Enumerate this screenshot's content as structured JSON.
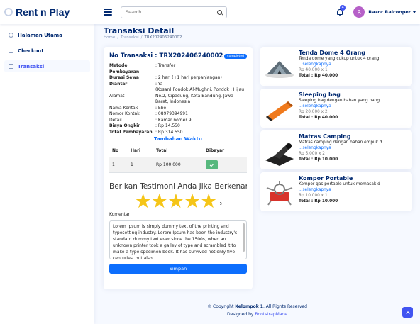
{
  "header": {
    "logo": "Rent n Play",
    "search_placeholder": "Search",
    "notif_count": "4",
    "avatar_letter": "R",
    "user_name": "Razor Raicooper"
  },
  "sidebar": {
    "items": [
      {
        "label": "Halaman Utama",
        "icon": "home-icon"
      },
      {
        "label": "Checkout",
        "icon": "cart-icon"
      },
      {
        "label": "Transaksi",
        "icon": "bag-icon",
        "active": true
      }
    ]
  },
  "page": {
    "title": "Transaksi Detail",
    "breadcrumb": [
      "Home",
      "/",
      "Transaksi",
      "/",
      "TRX202406240002"
    ]
  },
  "transaction": {
    "title_label": "No Transaksi :",
    "number": "TRX202406240002",
    "status": "completed",
    "rows": [
      {
        "k": "Metode Pembayaran",
        "v": ": Transfer",
        "bold": true
      },
      {
        "k": "Durasi Sewa",
        "v": ": 2 hari (+1 hari perpanjangan)",
        "bold": true
      },
      {
        "k": "Diantar",
        "v": ": Ya",
        "bold": true
      },
      {
        "k": "Alamat",
        "v": "(Kosan) Pondok Al-Mughni, Pondok : Hijau No.2, Cipadung, Kota Bandung, Jawa Barat, Indonesia",
        "bold": false
      },
      {
        "k": "Nama Kontak",
        "v": ": Ebe",
        "bold": false
      },
      {
        "k": "Nomor Kontak",
        "v": ": 08979394991",
        "bold": false
      },
      {
        "k": "Detail",
        "v": ": Kamar nomer 9",
        "bold": false
      },
      {
        "k": "Biaya Ongkir",
        "v": ": Rp 14.550",
        "bold": true
      },
      {
        "k": "Total Pembayaran",
        "v": ": Rp 314.550",
        "bold": true
      }
    ],
    "tambahan_title": "Tambahan Waktu",
    "table_headers": [
      "No",
      "Hari",
      "Total",
      "Dibayar"
    ],
    "table_rows": [
      {
        "no": "1",
        "hari": "1",
        "total": "Rp 100.000"
      }
    ]
  },
  "testimoni": {
    "title": "Berikan Testimoni Anda Jika Berkenan",
    "rating": 5,
    "rating_label": "5",
    "komentar_label": "Komentar",
    "komentar_text": "Lorem Ipsum is simply dummy text of the printing and typesetting industry. Lorem Ipsum has been the industry's standard dummy text ever since the 1500s, when an unknown printer took a galley of type and scrambled it to make a type specimen book. It has survived not only five centuries, but also",
    "save_label": "Simpan"
  },
  "products": [
    {
      "name": "Tenda Dome 4 Orang",
      "desc": "Tenda dome yang cukup untuk 4 orang",
      "more": "...selengkapnya",
      "qty": "Rp 40.000 x 1",
      "total": "Total : Rp 40.000",
      "icon": "tent-icon"
    },
    {
      "name": "Sleeping bag",
      "desc": "Sleeping bag dengan bahan yang hang",
      "more": "...selengkapnya",
      "qty": "Rp 20.000 x 2",
      "total": "Total : Rp 40.000",
      "icon": "sleeping-bag-icon"
    },
    {
      "name": "Matras Camping",
      "desc": "Matras camping dengan bahan empuk d",
      "more": "...selengkapnya",
      "qty": "Rp 5.000 x 2",
      "total": "Total : Rp 10.000",
      "icon": "mat-icon"
    },
    {
      "name": "Kompor Portable",
      "desc": "Kompor gas portable untuk memasak d",
      "more": "...selengkapnya",
      "qty": "Rp 10.000 x 1",
      "total": "Total : Rp 10.000",
      "icon": "stove-icon"
    }
  ],
  "footer": {
    "copyright_prefix": "© Copyright",
    "brand": "Kelompok 1",
    "rights": ". All Rights Reserved",
    "designed_prefix": "Designed by",
    "designer": "BootstrapMade"
  }
}
